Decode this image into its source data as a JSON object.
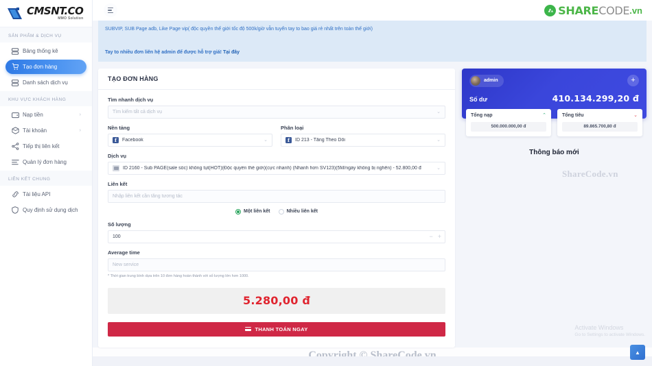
{
  "brand": {
    "logo_main": "CMSNT.CO",
    "logo_sub": "MMO Solution"
  },
  "sidebar": {
    "sections": [
      {
        "title": "SẢN PHẨM & DỊCH VỤ"
      },
      {
        "title": "KHU VỰC KHÁCH HÀNG"
      },
      {
        "title": "LIÊN KẾT CHUNG"
      }
    ],
    "items_products": [
      {
        "label": "Bảng thống kê",
        "icon": "server-icon",
        "active": false,
        "chevron": ""
      },
      {
        "label": "Tạo đơn hàng",
        "icon": "cart-icon",
        "active": true,
        "chevron": ""
      },
      {
        "label": "Danh sách dịch vụ",
        "icon": "server-icon",
        "active": false,
        "chevron": ""
      }
    ],
    "items_customer": [
      {
        "label": "Nạp tiền",
        "icon": "wallet-icon",
        "active": false,
        "chevron": "›"
      },
      {
        "label": "Tài khoản",
        "icon": "box-icon",
        "active": false,
        "chevron": "›"
      },
      {
        "label": "Tiếp thị liên kết",
        "icon": "share-icon",
        "active": false,
        "chevron": ""
      },
      {
        "label": "Quản lý đơn hàng",
        "icon": "list-icon",
        "active": false,
        "chevron": ""
      }
    ],
    "items_common": [
      {
        "label": "Tài liệu API",
        "icon": "link-icon",
        "active": false,
        "chevron": ""
      },
      {
        "label": "Quy định sử dụng dịch",
        "icon": "shield-icon",
        "active": false,
        "chevron": ""
      }
    ]
  },
  "topbar": {
    "menu_icon": "hamburger-icon",
    "sharecode": {
      "share": "SHARE",
      "code": "CODE",
      "vn": ".vn"
    }
  },
  "banner": {
    "line1": "SUBVIP, SUB Page adb, Like Page vip( độc quyền thế giới tốc độ 500k/giờ vẫn tuyển tay to bao giá rẻ nhất trên toàn thế giới)",
    "line2_text": "Tay to nhiều đơn liên hệ admin để được hỗ trợ giá!",
    "line2_link": "Tại đây"
  },
  "order_form": {
    "title": "TẠO ĐƠN HÀNG",
    "search_label": "Tìm nhanh dịch vụ",
    "search_placeholder": "Tìm kiếm tất cả dịch vụ",
    "platform_label": "Nền tảng",
    "platform_value": "Facebook",
    "category_label": "Phân loại",
    "category_value": "ID 213 - Tăng Theo Dõi",
    "service_label": "Dịch vụ",
    "service_value": "ID 2160 - Sub PAGE(sale sốc) không tụt(HOT)(Độc quyền thế giới)(cực nhanh) (Nhanh hơn SV123)(5M/ngày không bị nghẽn) - 52.800,00 đ",
    "link_label": "Liên kết",
    "link_placeholder": "Nhập liên kết cần tăng tương tác",
    "radio_single": "Một liên kết",
    "radio_multi": "Nhiều liên kết",
    "radio_selected": "single",
    "quantity_label": "Số lượng",
    "quantity_value": "100",
    "stepper_minus": "−",
    "stepper_plus": "+",
    "avgtime_label": "Average time",
    "avgtime_placeholder": "New service",
    "avgtime_hint": "* Thời gian trung bình dựa trên 10 đơn hàng hoàn thành với số lượng lớn hơn 1000.",
    "total_price": "5.280,00 đ",
    "pay_button": "THANH TOÁN NGAY"
  },
  "balance_card": {
    "username": "admin",
    "add_button": "+",
    "balance_label": "Số dư",
    "balance_value": "410.134.299,20 đ",
    "stats": [
      {
        "title": "Tổng nạp",
        "arrow": "⌃",
        "direction": "up",
        "value": "500.000.000,00 đ"
      },
      {
        "title": "Tổng tiêu",
        "arrow": "⌄",
        "direction": "down",
        "value": "89.865.700,80 đ"
      }
    ]
  },
  "notifications": {
    "title": "Thông báo mới"
  },
  "watermarks": {
    "middle": "ShareCode.vn",
    "bottom": "Copyright © ShareCode.vn"
  },
  "windows_activation": {
    "line1": "Activate Windows",
    "line2": "Go to Settings to activate Windows."
  },
  "scroll_top": {
    "icon": "chevron-up-icon",
    "label": "▲"
  },
  "colors": {
    "accent_blue": "#2f7ae5",
    "balance_card": "#3a46db",
    "price_red": "#e0242f",
    "pay_button": "#cf2846",
    "banner_bg": "#dce9f7",
    "radio_green": "#27a45c"
  }
}
